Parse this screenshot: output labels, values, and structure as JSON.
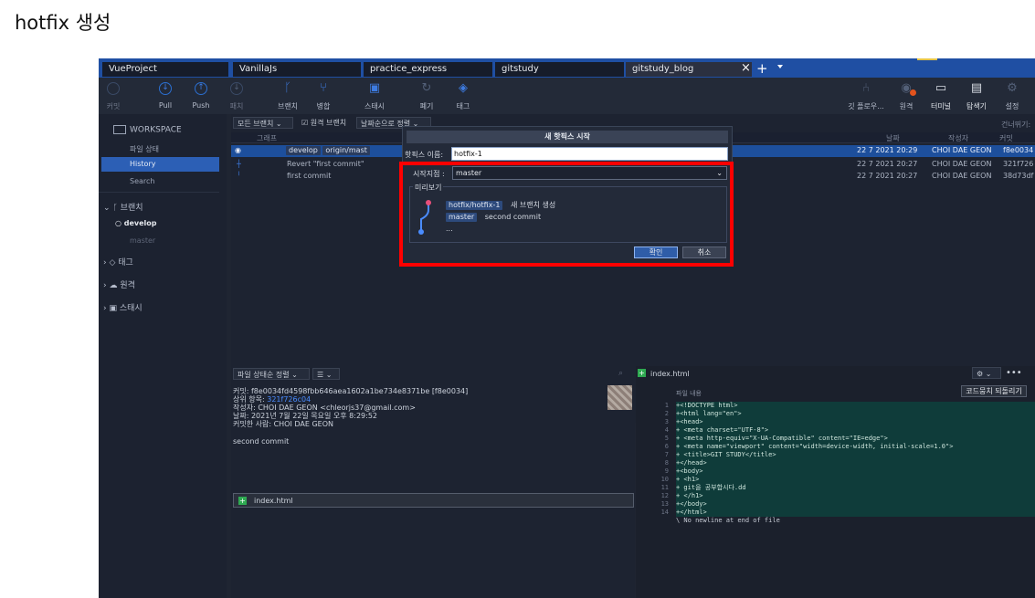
{
  "page_heading": "hotfix 생성",
  "tabs": [
    {
      "label": "VueProject"
    },
    {
      "label": "VanillaJs"
    },
    {
      "label": "practice_express"
    },
    {
      "label": "gitstudy"
    },
    {
      "label": "gitstudy_blog"
    }
  ],
  "tab_controls": {
    "close": "×",
    "add": "+"
  },
  "toolbar": {
    "commit": "커밋",
    "pull": "Pull",
    "push": "Push",
    "fetch": "패치",
    "branch": "브랜치",
    "merge": "병합",
    "stash": "스태시",
    "discard": "폐기",
    "tag": "태그",
    "gitflow": "깃 플로우...",
    "remote": "원격",
    "terminal": "터미널",
    "explorer": "탐색기",
    "settings": "설정"
  },
  "sidebar": {
    "workspace": "WORKSPACE",
    "file_status": "파일 상태",
    "history": "History",
    "search": "Search",
    "branches": "브랜치",
    "branch_develop": "develop",
    "branch_master": "master",
    "tags": "태그",
    "remotes": "원격",
    "stashes": "스태시"
  },
  "filters": {
    "branches": "모든 브랜치",
    "remote_branches": "원격 브랜치",
    "sort": "날짜순으로 정렬",
    "skip": "건너뛰기:"
  },
  "columns": {
    "graph": "그래프",
    "date": "날짜",
    "author": "작성자",
    "commit": "커밋"
  },
  "commits": [
    {
      "tags": [
        "develop",
        "origin/mast"
      ],
      "date": "22 7 2021 20:29",
      "author": "CHOI DAE GEON",
      "hash": "f8e0034"
    },
    {
      "message": "Revert \"first commit\"",
      "date": "22 7 2021 20:27",
      "author": "CHOI DAE GEON",
      "hash": "321f726"
    },
    {
      "message": "first commit",
      "date": "22 7 2021 20:27",
      "author": "CHOI DAE GEON",
      "hash": "38d73df"
    }
  ],
  "dialog": {
    "title": "새 핫픽스 시작",
    "name_label": "핫픽스 이름:",
    "name_value": "hotfix-1",
    "start_label": "시작지점 :",
    "start_value": "master",
    "preview_label": "미리보기",
    "preview_branch": "hotfix/hotfix-1",
    "preview_branch_msg": "새 브랜치 생성",
    "preview_master": "master",
    "preview_master_msg": "second commit",
    "ellipsis": "...",
    "ok": "확인",
    "cancel": "취소"
  },
  "details": {
    "sort_label": "파일 상태순 정렬",
    "commit": "커밋: f8e0034fd4598fbb646aea1602a1be734e8371be [f8e0034]",
    "parent_label": "상위 항목:",
    "parent_value": "321f726c04",
    "author": "작성자: CHOI DAE GEON <chleorjs37@gmail.com>",
    "date": "날짜: 2021년 7월 22일 목요일 오후 8:29:52",
    "committer": "커밋한 사람: CHOI DAE GEON",
    "message": "second commit",
    "file": "index.html"
  },
  "diff": {
    "file": "index.html",
    "header": "파일 내용",
    "revert_button": "코드뭉치 되돌리기",
    "lines": [
      {
        "n": "1",
        "text": "+<!DOCTYPE html>"
      },
      {
        "n": "2",
        "text": "+<html lang=\"en\">"
      },
      {
        "n": "3",
        "text": "+<head>"
      },
      {
        "n": "4",
        "text": "+    <meta charset=\"UTF-8\">"
      },
      {
        "n": "5",
        "text": "+    <meta http-equiv=\"X-UA-Compatible\" content=\"IE=edge\">"
      },
      {
        "n": "6",
        "text": "+    <meta name=\"viewport\" content=\"width=device-width, initial-scale=1.0\">"
      },
      {
        "n": "7",
        "text": "+    <title>GIT STUDY</title>"
      },
      {
        "n": "8",
        "text": "+</head>"
      },
      {
        "n": "9",
        "text": "+<body>"
      },
      {
        "n": "10",
        "text": "+    <h1>"
      },
      {
        "n": "11",
        "text": "+        git을 공부합시다.dd"
      },
      {
        "n": "12",
        "text": "+    </h1>"
      },
      {
        "n": "13",
        "text": "+</body>"
      },
      {
        "n": "14",
        "text": "+</html>"
      }
    ],
    "no_newline": "\\ No newline at end of file"
  }
}
